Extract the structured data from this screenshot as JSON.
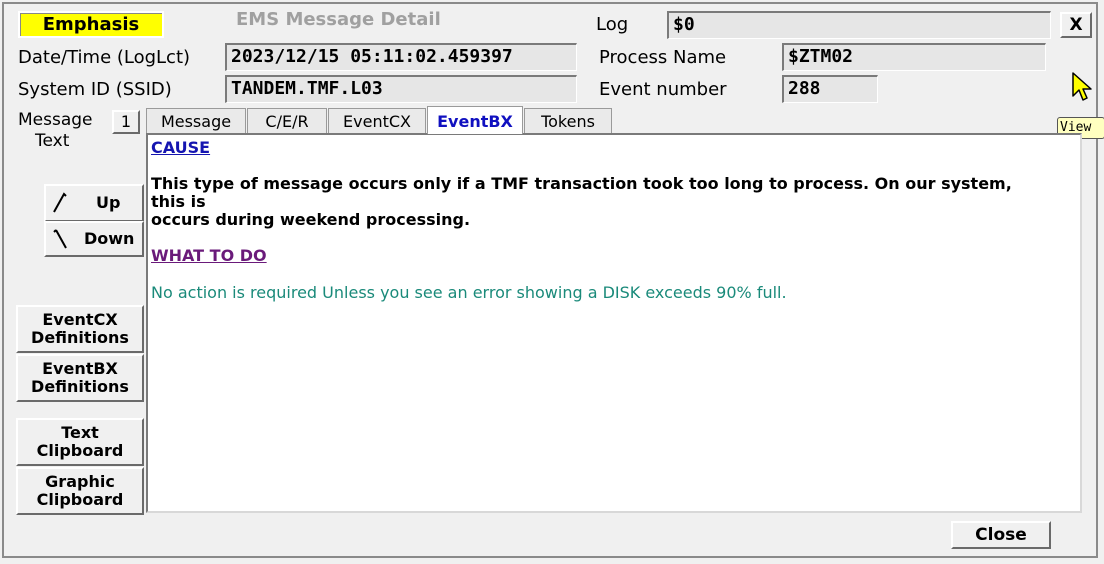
{
  "header": {
    "emphasis_label": "Emphasis",
    "window_title": "EMS Message Detail",
    "log_label": "Log",
    "log_value": "$0",
    "close_x": "X"
  },
  "fields": {
    "datetime_label": "Date/Time (LogLct)",
    "datetime_value": "2023/12/15 05:11:02.459397",
    "process_label": "Process Name",
    "process_value": "$ZTM02",
    "ssid_label": "System ID (SSID)",
    "ssid_value": "TANDEM.TMF.L03",
    "event_label": "Event number",
    "event_value": "288"
  },
  "message": {
    "label_line1": "Message",
    "label_line2": "Text",
    "index": "1",
    "up_label": "Up",
    "down_label": "Down"
  },
  "side_buttons": {
    "eventcx_line1": "EventCX",
    "eventcx_line2": "Definitions",
    "eventbx_line1": "EventBX",
    "eventbx_line2": "Definitions",
    "textclip_line1": "Text",
    "textclip_line2": "Clipboard",
    "graphclip_line1": "Graphic",
    "graphclip_line2": "Clipboard"
  },
  "tabs": [
    {
      "label": "Message"
    },
    {
      "label": "C/E/R"
    },
    {
      "label": "EventCX"
    },
    {
      "label": "EventBX",
      "active": true
    },
    {
      "label": "Tokens"
    }
  ],
  "content": {
    "cause_heading": "CAUSE",
    "cause_line1": "This type of message occurs only if a TMF transaction took too long to process. On our system, this is",
    "cause_line2": "occurs during weekend processing.",
    "what_heading": "WHAT TO DO",
    "action_text": "No action is required Unless you see an error showing a DISK exceeds 90% full."
  },
  "footer": {
    "close_label": "Close"
  },
  "tooltip": {
    "text": "View"
  },
  "colors": {
    "emphasis_bg": "#ffff00",
    "active_tab": "#1010c0",
    "cause_heading": "#1515b0",
    "what_heading": "#6a1a7a",
    "action_text": "#1a8a7a",
    "cursor": "#ffff00"
  },
  "icons": {
    "cursor": "mouse-pointer-icon",
    "up": "up-arrow-icon",
    "down": "down-arrow-icon"
  }
}
